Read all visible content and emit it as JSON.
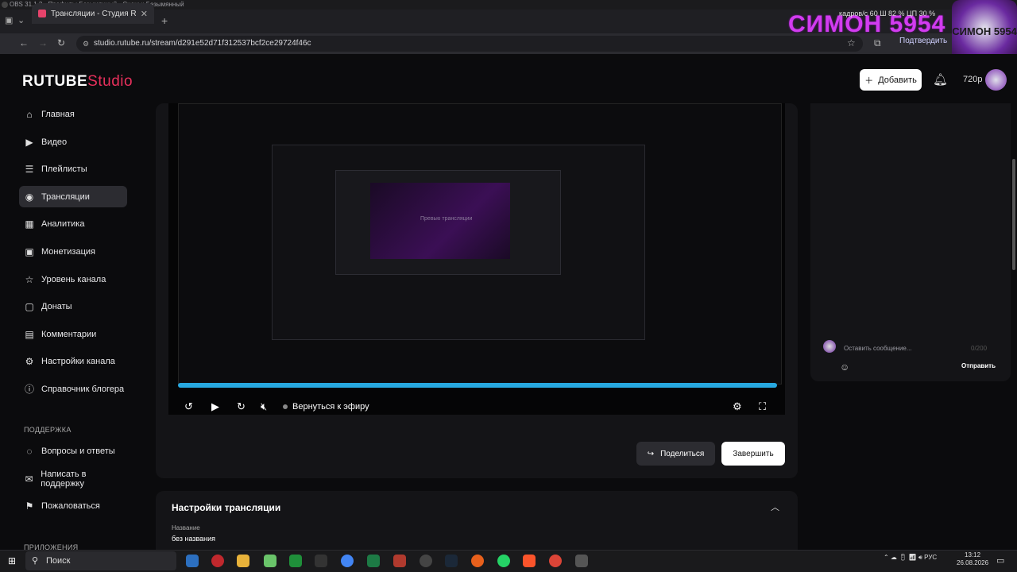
{
  "obs": {
    "title": "OBS 31.1.2 - Профиль: Безымянный - Сцены: Безымянный"
  },
  "browser": {
    "tab_title": "Трансляции - Студия RUTUBE",
    "new_tab": "+",
    "url": "studio.rutube.ru/stream/d291e52d71f312537bcf2ce29724f46c",
    "confirm_label": "Подтвердить"
  },
  "overlay": {
    "stream_name": "СИМОН 5954",
    "stats": "кадров/с 60   Ш 82 %   ЦП 30 %",
    "badge_text": "СИМОН 5954"
  },
  "header": {
    "logo": "RUTUBE",
    "logo_suffix": "Studio",
    "add_label": "Добавить",
    "quality": "720p"
  },
  "sidebar": {
    "items": [
      {
        "label": "Главная",
        "icon": "⌂"
      },
      {
        "label": "Видео",
        "icon": "▶"
      },
      {
        "label": "Плейлисты",
        "icon": "☰"
      },
      {
        "label": "Трансляции",
        "icon": "◉"
      },
      {
        "label": "Аналитика",
        "icon": "▦"
      },
      {
        "label": "Монетизация",
        "icon": "▣"
      },
      {
        "label": "Уровень канала",
        "icon": "☆"
      },
      {
        "label": "Донаты",
        "icon": "▢"
      },
      {
        "label": "Комментарии",
        "icon": "▤"
      },
      {
        "label": "Настройки канала",
        "icon": "⚙"
      },
      {
        "label": "Справочник блогера",
        "icon": "ⓘ"
      }
    ],
    "support_heading": "ПОДДЕРЖКА",
    "support_items": [
      {
        "label": "Вопросы и ответы",
        "icon": "◌"
      },
      {
        "label": "Написать в поддержку",
        "icon": "✉"
      },
      {
        "label": "Пожаловаться",
        "icon": "⚑"
      }
    ],
    "apps_heading": "ПРИЛОЖЕНИЯ"
  },
  "player": {
    "preview_text": "Превью трансляции",
    "live_label": "Вернуться к эфиру",
    "share_label": "Поделиться",
    "finish_label": "Завершить",
    "progress": 1.0
  },
  "chat": {
    "placeholder": "Оставить сообщение...",
    "counter": "0/200",
    "send_label": "Отправить"
  },
  "settings": {
    "title": "Настройки трансляции",
    "name_label": "Название",
    "name_value": "без названия"
  },
  "taskbar": {
    "search_placeholder": "Поиск",
    "lang": "РУС",
    "time": "13:12",
    "date": "26.08.2026"
  }
}
